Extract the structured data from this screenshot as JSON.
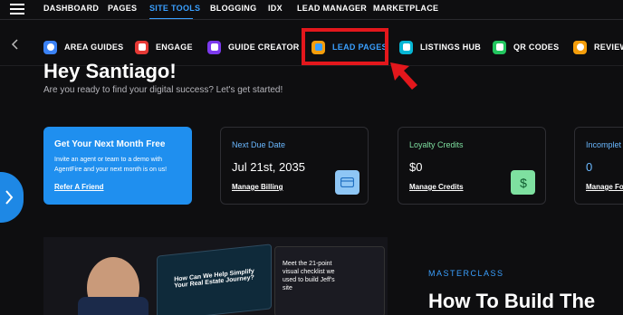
{
  "topnav": {
    "items": [
      "DASHBOARD",
      "PAGES",
      "SITE TOOLS",
      "BLOGGING",
      "IDX",
      "LEAD MANAGER",
      "MARKETPLACE"
    ],
    "active_color": "#3aa0ff"
  },
  "tools": [
    {
      "label": "AREA GUIDES",
      "icon": "area-guides-icon",
      "color": "#3b82f6"
    },
    {
      "label": "ENGAGE",
      "icon": "engage-icon",
      "color": "#e53935"
    },
    {
      "label": "GUIDE CREATOR",
      "icon": "guide-creator-icon",
      "color": "#7c3aed"
    },
    {
      "label": "LEAD PAGES",
      "icon": "lead-pages-icon",
      "color": "#f59e0b"
    },
    {
      "label": "LISTINGS HUB",
      "icon": "listings-hub-icon",
      "color": "#06b6d4"
    },
    {
      "label": "QR CODES",
      "icon": "qr-codes-icon",
      "color": "#22c55e"
    },
    {
      "label": "REVIEW",
      "icon": "review-icon",
      "color": "#f59e0b"
    }
  ],
  "greeting": {
    "title": "Hey Santiago!",
    "subtitle": "Are you ready to find your digital success? Let's get started!"
  },
  "promo": {
    "title": "Get Your Next Month Free",
    "body": "Invite an agent or team to a demo with AgentFire and your next month is on us!",
    "link": "Refer A Friend"
  },
  "due": {
    "label": "Next Due Date",
    "value": "Jul 21st, 2035",
    "link": "Manage Billing",
    "label_color": "#6ab8ff"
  },
  "credits": {
    "label": "Loyalty Credits",
    "value": "$0",
    "link": "Manage Credits",
    "label_color": "#7ee0a0"
  },
  "incomplete": {
    "label": "Incomplet",
    "value": "0",
    "link": "Manage For",
    "label_color": "#6ab8ff"
  },
  "masterclass": {
    "eyebrow": "MASTERCLASS",
    "title": "How To Build The"
  },
  "hero_text": {
    "headline": "How Can We Help Simplify Your Real Estate Journey?",
    "checklist": "Meet the 21-point visual checklist we used to build Jeff's site"
  },
  "colors": {
    "highlight": "#e3171c",
    "accent": "#1f8fef"
  }
}
